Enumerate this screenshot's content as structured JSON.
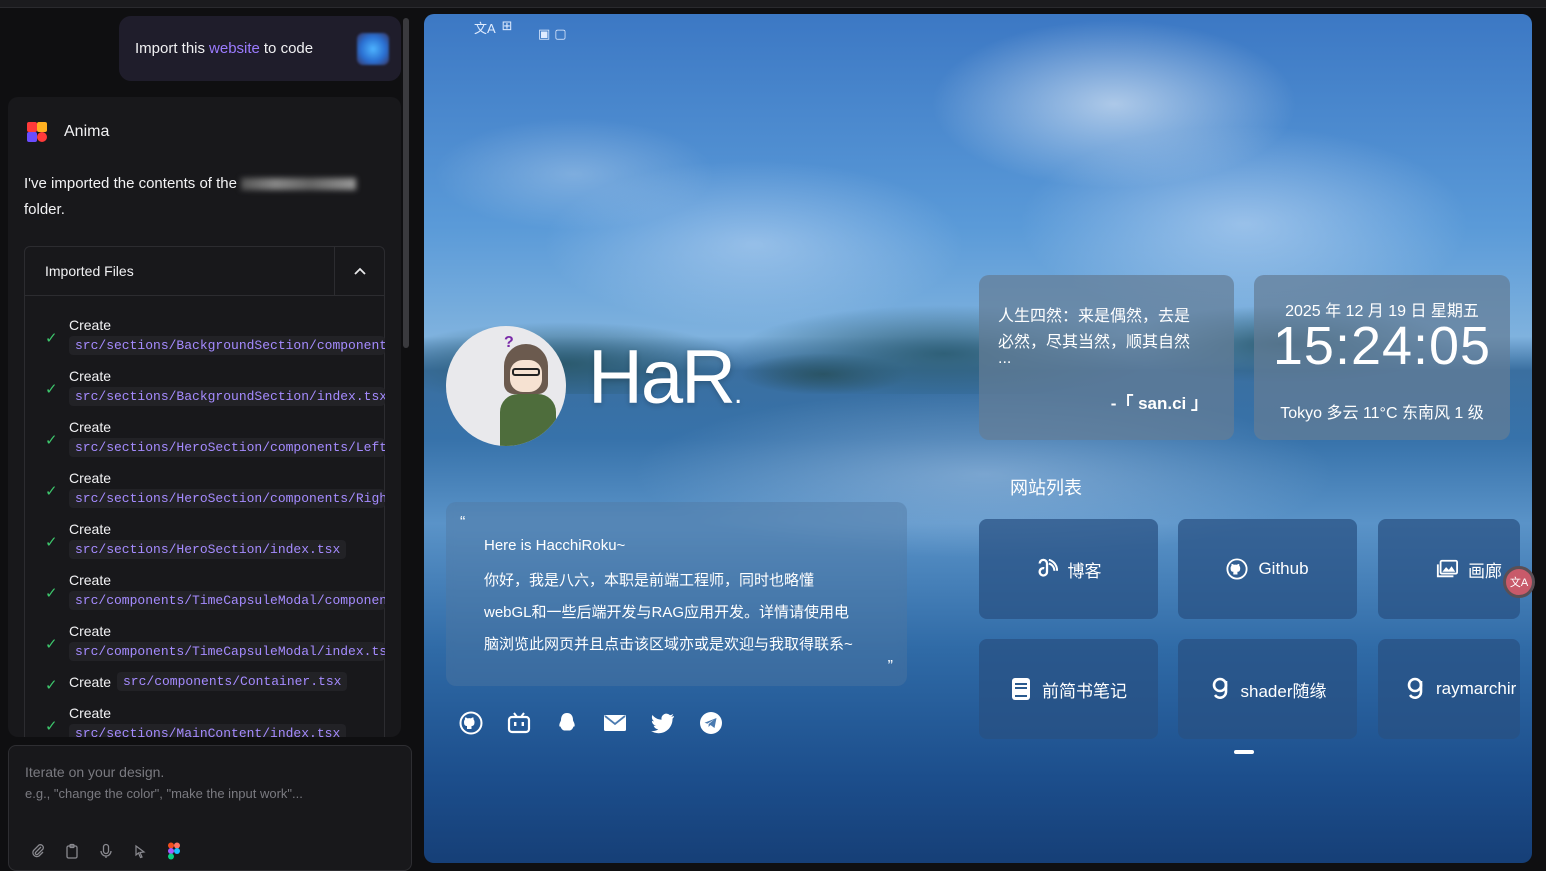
{
  "import_banner": {
    "prefix": "Import this",
    "link": "website",
    "suffix": "to code"
  },
  "chat": {
    "agent_name": "Anima",
    "message_prefix": "I've imported the contents of the",
    "message_suffix": "folder.",
    "files_title": "Imported Files",
    "files": [
      {
        "action": "Create",
        "path": "src/sections/BackgroundSection/components/"
      },
      {
        "action": "Create",
        "path": "src/sections/BackgroundSection/index.tsx"
      },
      {
        "action": "Create",
        "path": "src/sections/HeroSection/components/Left"
      },
      {
        "action": "Create",
        "path": "src/sections/HeroSection/components/Righ"
      },
      {
        "action": "Create",
        "path": "src/sections/HeroSection/index.tsx"
      },
      {
        "action": "Create",
        "path": "src/components/TimeCapsuleModal/componen"
      },
      {
        "action": "Create",
        "path": "src/components/TimeCapsuleModal/index.ts"
      },
      {
        "action": "Create",
        "path": "src/components/Container.tsx"
      },
      {
        "action": "Create",
        "path": "src/sections/MainContent/index.tsx"
      }
    ]
  },
  "input": {
    "placeholder_line1": "Iterate on your design.",
    "placeholder_line2": "e.g., \"change the color\", \"make the input work\"...",
    "tools": [
      "paperclip-icon",
      "clipboard-icon",
      "microphone-icon",
      "cursor-select-icon",
      "figma-icon"
    ]
  },
  "preview": {
    "hero_name": "HaR",
    "hero_dot": ".",
    "quote_lines": [
      "Here is HacchiRoku~",
      "你好，我是八六，本职是前端工程师，同时也略懂",
      "webGL和一些后端开发与RAG应用开发。详情请使用电",
      "脑浏览此网页并且点击该区域亦或是欢迎与我取得联系~"
    ],
    "quote_open": "“",
    "quote_close": "”",
    "socials": [
      "github-icon",
      "bilibili-icon",
      "qq-icon",
      "mail-icon",
      "twitter-icon",
      "telegram-icon"
    ],
    "poem_lines": [
      "人生四然：来是偶然，去是",
      "必然，尽其当然，顺其自然",
      "..."
    ],
    "poem_source": "-「 san.ci 」",
    "date": "2025 年 12 月 19 日 星期五",
    "clock": "15:24:05",
    "weather": "Tokyo 多云 11°C  东南风  1 级",
    "sites_title": "网站列表",
    "sites": [
      {
        "label": "博客",
        "icon": "blog-icon"
      },
      {
        "label": "Github",
        "icon": "github-icon"
      },
      {
        "label": "画廊",
        "icon": "gallery-icon"
      },
      {
        "label": "前简书笔记",
        "icon": "notebook-icon"
      },
      {
        "label": "shader随缘",
        "icon": "glitch-icon"
      },
      {
        "label": "raymarchir",
        "icon": "glitch-icon"
      }
    ]
  }
}
